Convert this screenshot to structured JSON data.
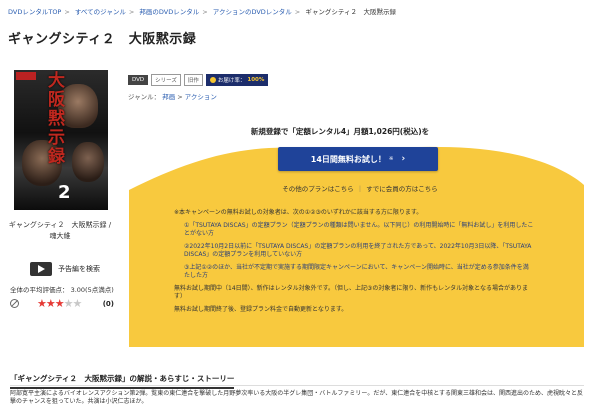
{
  "breadcrumb": [
    "DVDレンタルTOP",
    "すべてのジャンル",
    "邦画のDVDレンタル",
    "アクションのDVDレンタル",
    "ギャングシティ２　大阪黙示録"
  ],
  "title": "ギャングシティ２　大阪黙示録",
  "poster": {
    "title_text": "大阪黙示録",
    "number": "2"
  },
  "caption": "ギャングシティ２　大阪黙示録 / 魂大維",
  "trailer_label": "予告編を検索",
  "avg_rating_text": "全体の平均評価点： 3.00(5点満点)",
  "rating": {
    "value": 3,
    "max": 5,
    "count": "(0)"
  },
  "tags": {
    "format": "DVD",
    "series": "シリーズ",
    "old": "旧作",
    "points_label": "お届け率：",
    "points_value": "100%"
  },
  "genre": {
    "label": "ジャンル：",
    "items": [
      "邦画",
      "アクション"
    ]
  },
  "promo": {
    "headline": "新規登録で「定額レンタル4」月額1,026円(税込)を",
    "cta_label": "14日間無料お試し！",
    "cta_small": "※",
    "link_other": "その他のプランはこちら",
    "link_member": "すでに会員の方はこちら",
    "notes": [
      "※本キャンペーンの無料お試しの対象者は、次の①②③のいずれかに該当する方に限ります。",
      "①「TSUTAYA DISCAS」の定額プラン（定額プランの種類は問いません。以下同じ）の利用開始時に「無料お試し」を利用したことがない方",
      "②2022年10月2日以前に「TSUTAYA DISCAS」の定額プランの利用を終了された方であって、2022年10月3日以降、「TSUTAYA DISCAS」の定額プランを利用していない方",
      "③上記①②のほか、当社が不定期で実施する期間限定キャンペーンにおいて、キャンペーン開始時に、当社が定める参加条件を満たした方",
      "無料お試し期間中（14日間）、新作はレンタル対象外です。（但し、上記③の対象者に限り、新作もレンタル対象となる場合があります）",
      "無料お試し期間終了後、登録プラン料金で自動更新となります。"
    ]
  },
  "section_title": "「ギャングシティ２　大阪黙示録」の解説・あらすじ・ストーリー",
  "synopsis": "阿部寛平主演によるバイオレンスアクション第2弾。覧東の東仁連合を撃破した月野夢次率いる大阪の半グレ集団・バトルファミリー。だが、東仁連合を中核とする関東三雄和会は、関西進出のため、虎視眈々と反撃のチャンスを狙っていた。共演は小沢仁志ほか。",
  "colors": {
    "yellow": "#f8c93e",
    "button": "#1f4399",
    "link": "#2a5db0",
    "star": "#e53935"
  }
}
